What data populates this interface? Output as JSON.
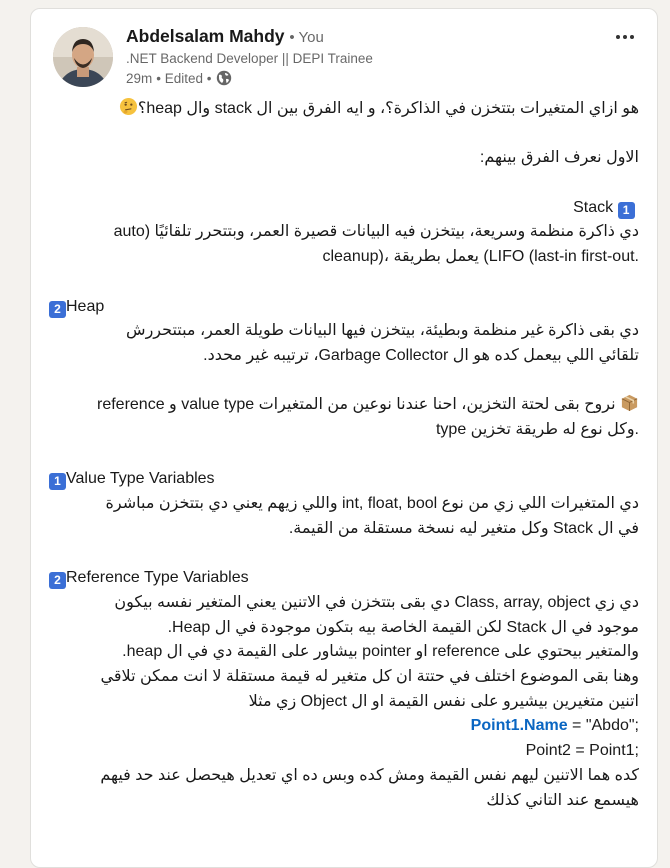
{
  "author": {
    "name": "Abdelsalam Mahdy",
    "you_label": "• You",
    "headline": ".NET Backend Developer || DEPI Trainee",
    "time": "29m",
    "edited": "• Edited •"
  },
  "colors": {
    "badge": "#3b6fd6",
    "link_blue": "#0a66c2"
  },
  "icons": {
    "globe": "globe-icon",
    "more": "more-options-icon",
    "thinking": "thinking-face-emoji",
    "box": "package-emoji"
  },
  "post": {
    "question": "هو ازاي المتغيرات بتتخزن في الذاكرة؟، و ايه الفرق بين ال stack وال heap؟",
    "intro": "الاول نعرف الفرق بينهم:",
    "stack_num": "1",
    "stack_title": "Stack",
    "stack_line1": "دي ذاكرة منظمة وسريعة، بيتخزن فيه البيانات قصيرة العمر، وبتتحرر تلقائيًا (auto",
    "stack_line2": "cleanup)، يعمل بطريقة (LIFO (last-in first-out.",
    "heap_num": "2",
    "heap_title": "Heap",
    "heap_line1": "دي بقى ذاكرة غير منظمة وبطيئة، بيتخزن فيها البيانات طويلة العمر، مبتتحررش",
    "heap_line2": "تلقائي اللي بيعمل كده هو ال Garbage Collector، ترتيبه غير محدد.",
    "storage_line1": "نروح بقى لحتة التخزين، احنا عندنا نوعين من المتغيرات value type و reference",
    "storage_line2": "type وكل نوع له طريقة تخزين.",
    "value_num": "1",
    "value_title": "Value Type Variables",
    "value_line1": "دي المتغيرات اللي زي من نوع int, float, bool واللي زيهم يعني دي بتتخزن مباشرة",
    "value_line2": "في ال Stack وكل متغير ليه نسخة مستقلة من القيمة.",
    "ref_num": "2",
    "ref_title": "Reference Type Variables",
    "ref_line1": "دي زي Class, array, object دي بقى بتتخزن في الاتنين يعني المتغير نفسه بيكون",
    "ref_line2": "موجود في ال Stack لكن القيمة الخاصة بيه بتكون موجودة في ال Heap.",
    "ref_line3": "والمتغير بيحتوي على reference او pointer بيشاور على القيمة دي في ال heap.",
    "ref_line4": "وهنا بقى الموضوع اختلف في حتتة ان كل متغير له قيمة مستقلة لا انت ممكن تلاقي",
    "ref_line5": "اتنين متغيرين بيشيرو على نفس القيمة او ال Object زي مثلا",
    "code1_link": "Point1.Name",
    "code1_rest": " = \"Abdo\";",
    "code2": "Point2 = Point1;",
    "end_line1": "كده هما الاتنين ليهم نفس القيمة ومش كده وبس ده اي تعديل هيحصل عند حد فيهم",
    "end_line2": "هيسمع عند التاني كذلك"
  }
}
